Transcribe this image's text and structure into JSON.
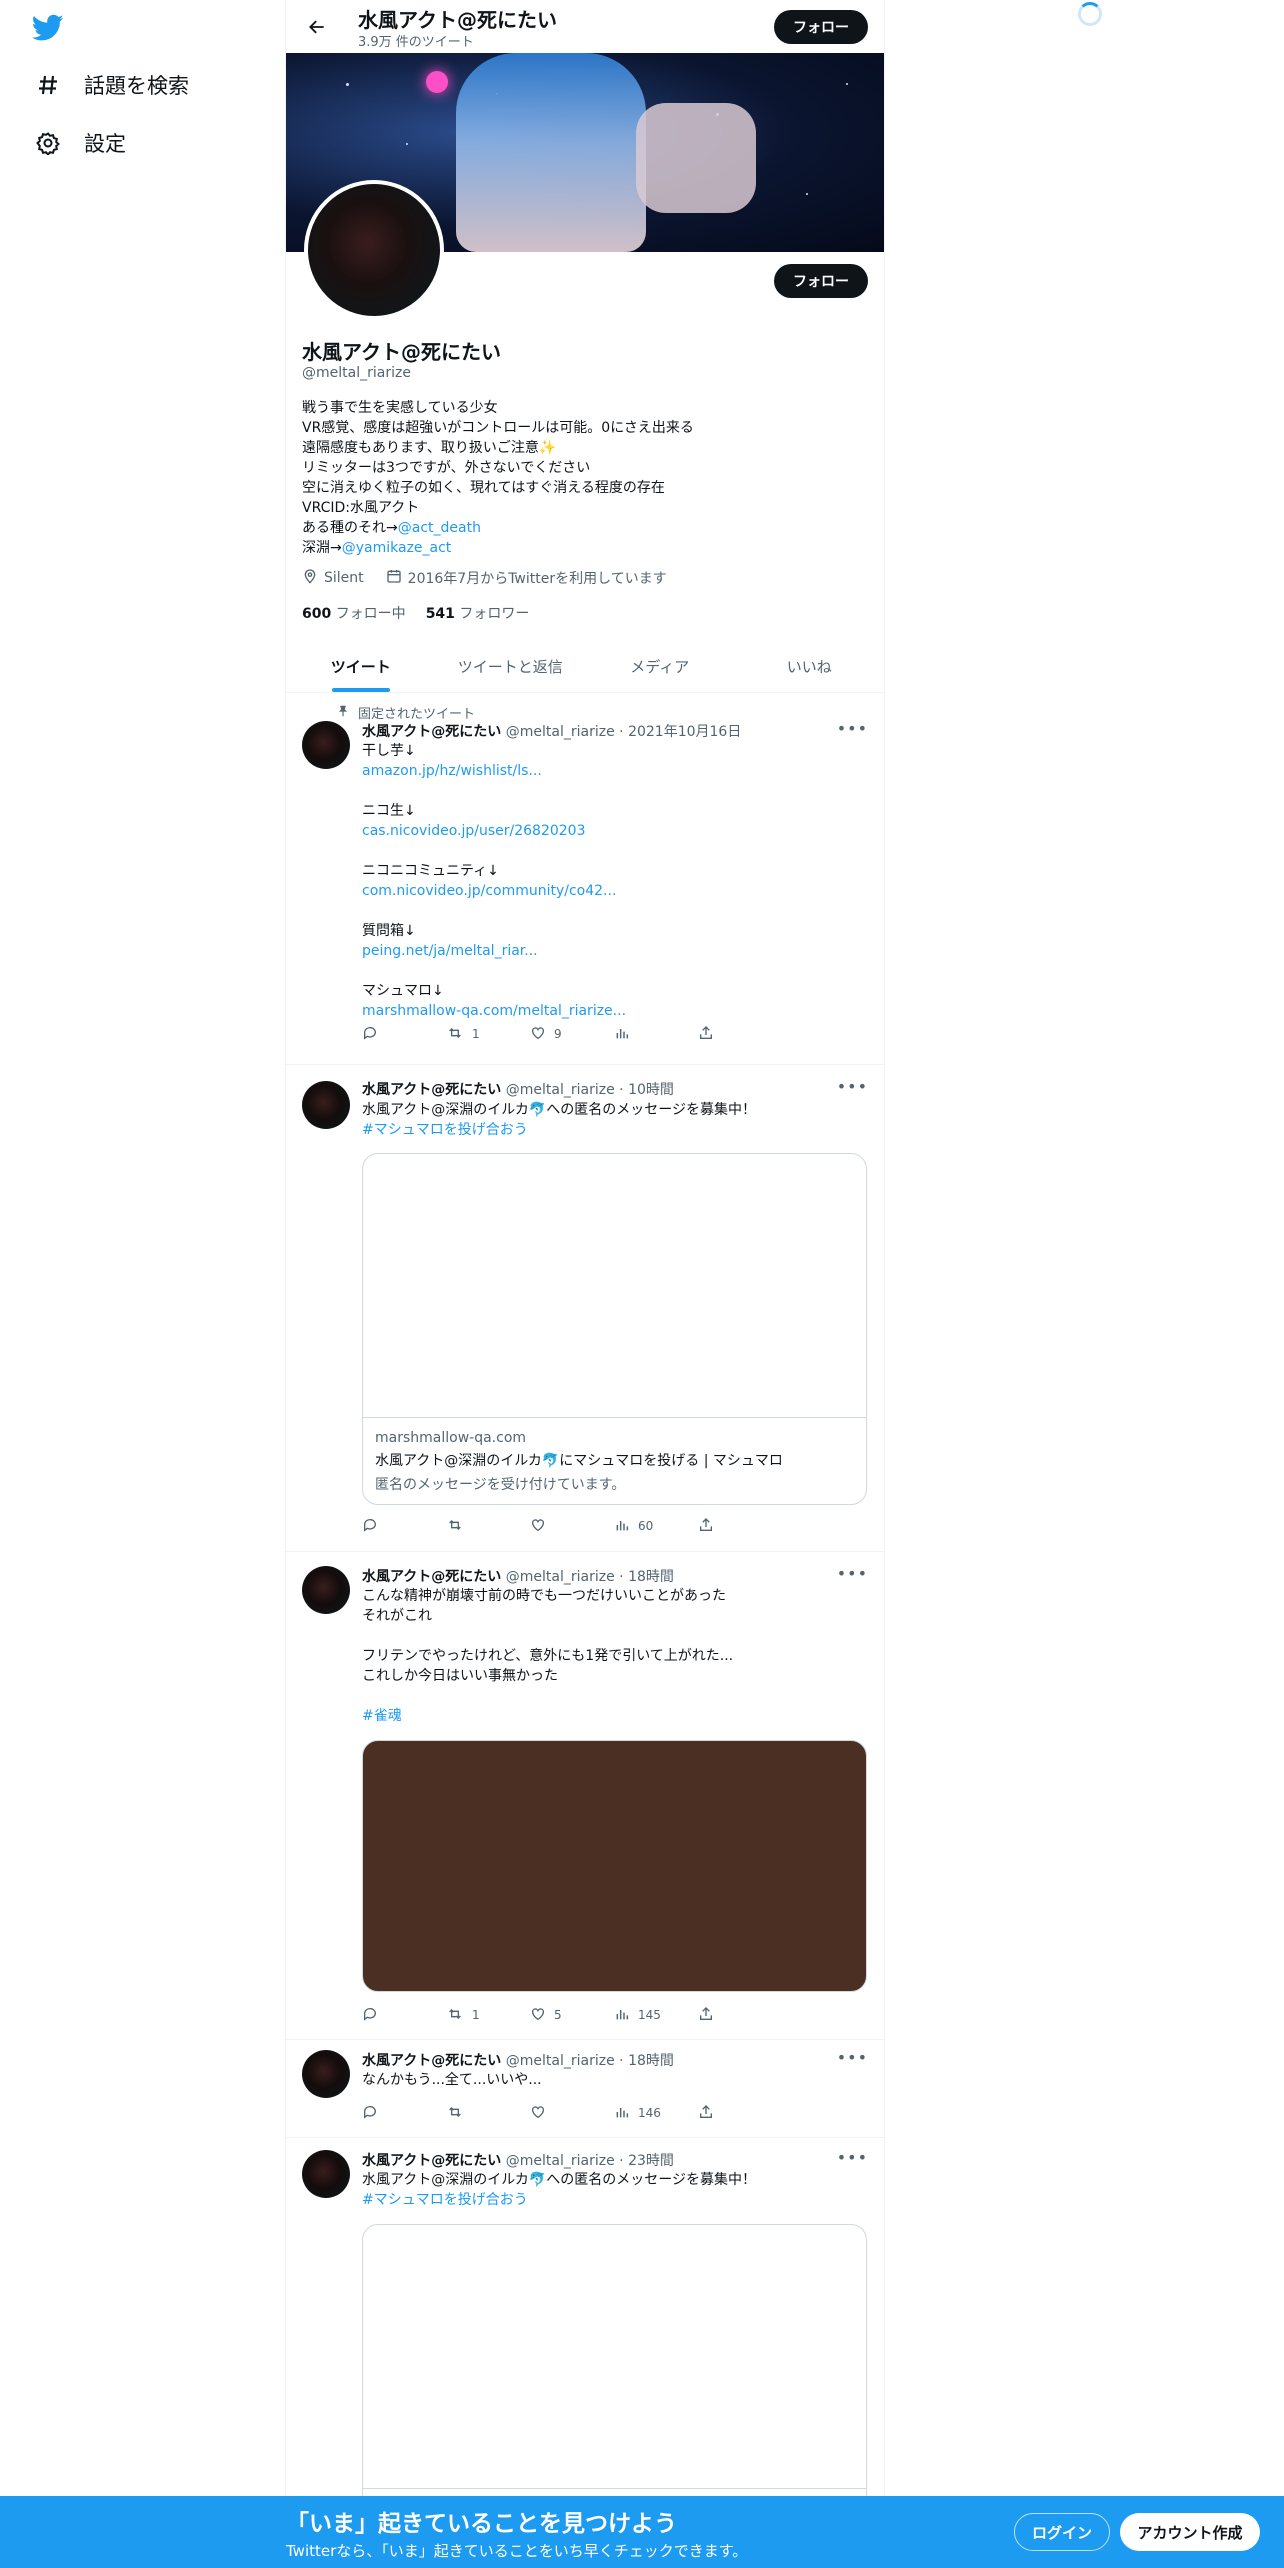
{
  "nav": {
    "logo": "twitter-bird-icon",
    "items": [
      {
        "label": "話題を検索",
        "icon": "hashtag-icon"
      },
      {
        "label": "設定",
        "icon": "gear-icon"
      }
    ]
  },
  "header": {
    "name": "水風アクト@死にたい",
    "tweet_count": "3.9万 件のツイート",
    "follow_label": "フォロー"
  },
  "profile": {
    "name": "水風アクト@死にたい",
    "handle": "@meltal_riarize",
    "follow_label": "フォロー",
    "bio": [
      {
        "text": "戦う事で生を実感している少女"
      },
      {
        "text": "VR感覚、感度は超強いがコントロールは可能。0にさえ出来る"
      },
      {
        "text": "遠隔感度もあります、取り扱いご注意✨"
      },
      {
        "text": "リミッターは3つですが、外さないでください"
      },
      {
        "text": "空に消えゆく粒子の如く、現れてはすぐ消える程度の存在"
      },
      {
        "text": "VRCID:水風アクト"
      },
      {
        "text": "ある種のそれ→",
        "link": "@act_death"
      },
      {
        "text": "深淵→",
        "link": "@yamikaze_act"
      }
    ],
    "location": "Silent",
    "joined": "2016年7月からTwitterを利用しています",
    "following_count": "600",
    "following_label": "フォロー中",
    "followers_count": "541",
    "followers_label": "フォロワー"
  },
  "tabs": [
    {
      "label": "ツイート",
      "active": true
    },
    {
      "label": "ツイートと返信",
      "active": false
    },
    {
      "label": "メディア",
      "active": false
    },
    {
      "label": "いいね",
      "active": false
    }
  ],
  "tweets": [
    {
      "pinned_label": "固定されたツイート",
      "name": "水風アクト@死にたい",
      "handle": "@meltal_riarize",
      "time": "2021年10月16日",
      "lines": [
        {
          "text": "干し芋↓"
        },
        {
          "text": "amazon.jp/hz/wishlist/ls...",
          "link": true
        },
        {
          "text": ""
        },
        {
          "text": "ニコ生↓"
        },
        {
          "text": " cas.nicovideo.jp/user/26820203",
          "link": true
        },
        {
          "text": ""
        },
        {
          "text": "ニコニコミュニティ↓"
        },
        {
          "text": "com.nicovideo.jp/community/co42...",
          "link": true
        },
        {
          "text": ""
        },
        {
          "text": "質問箱↓"
        },
        {
          "text": "peing.net/ja/meltal_riar...",
          "link": true
        },
        {
          "text": ""
        },
        {
          "text": "マシュマロ↓"
        },
        {
          "text": "marshmallow-qa.com/meltal_riarize...",
          "link": true
        }
      ],
      "replies": "",
      "retweets": "1",
      "likes": "9",
      "views": ""
    },
    {
      "name": "水風アクト@死にたい",
      "handle": "@meltal_riarize",
      "time": "10時間",
      "lines": [
        {
          "text": "水風アクト@深淵のイルカ🐬への匿名のメッセージを募集中！"
        },
        {
          "text": "#マシュマロを投げ合おう",
          "link": true
        }
      ],
      "card": {
        "domain": "marshmallow-qa.com",
        "title": "水風アクト@深淵のイルカ🐬にマシュマロを投げる | マシュマロ",
        "description": "匿名のメッセージを受け付けています。"
      },
      "replies": "",
      "retweets": "",
      "likes": "",
      "views": "60"
    },
    {
      "name": "水風アクト@死にたい",
      "handle": "@meltal_riarize",
      "time": "18時間",
      "lines": [
        {
          "text": "こんな精神が崩壊寸前の時でも一つだけいいことがあった"
        },
        {
          "text": "それがこれ"
        },
        {
          "text": ""
        },
        {
          "text": "フリテンでやったけれど、意外にも1発で引いて上がれた..."
        },
        {
          "text": "これしか今日はいい事無かった"
        },
        {
          "text": ""
        },
        {
          "text": "#雀魂",
          "link": true
        }
      ],
      "replies": "",
      "retweets": "1",
      "likes": "5",
      "views": "145"
    },
    {
      "name": "水風アクト@死にたい",
      "handle": "@meltal_riarize",
      "time": "18時間",
      "lines": [
        {
          "text": "なんかもう...全て...いいや..."
        }
      ],
      "replies": "",
      "retweets": "",
      "likes": "",
      "views": "146"
    },
    {
      "name": "水風アクト@死にたい",
      "handle": "@meltal_riarize",
      "time": "23時間",
      "lines": [
        {
          "text": "水風アクト@深淵のイルカ🐬への匿名のメッセージを募集中！"
        },
        {
          "text": "#マシュマロを投げ合おう",
          "link": true
        }
      ]
    }
  ],
  "bottom_bar": {
    "title": "「いま」起きていることを見つけよう",
    "subtitle": "Twitterなら、「いま」起きていることをいち早くチェックできます。",
    "login_label": "ログイン",
    "signup_label": "アカウント作成"
  },
  "colors": {
    "accent": "#1d9bf0",
    "text": "#0f1419",
    "secondary": "#536471",
    "border": "#eff3f4"
  }
}
